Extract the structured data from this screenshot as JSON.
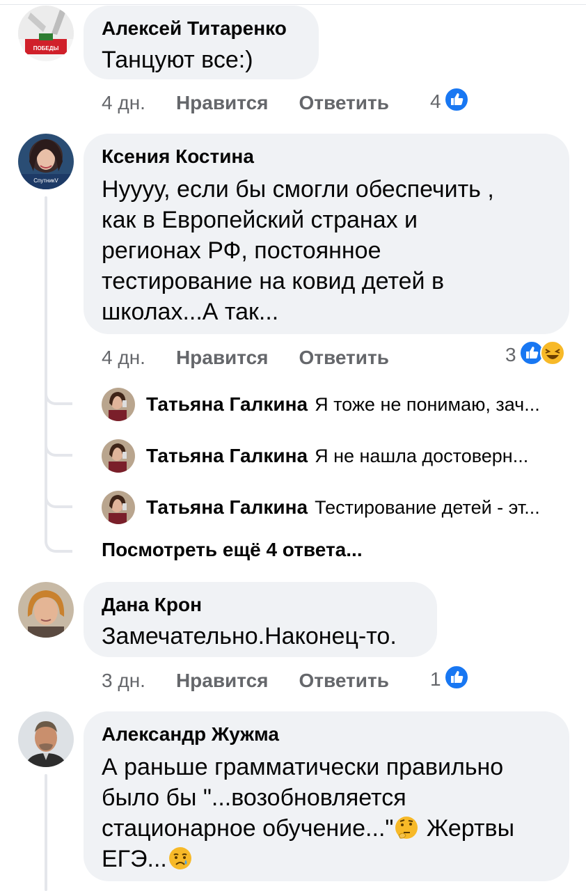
{
  "comments": [
    {
      "author": "Алексей Титаренко",
      "text": "Танцуют все:)",
      "time": "4 дн.",
      "like_label": "Нравится",
      "reply_label": "Ответить",
      "reaction_count": "4",
      "avatar_caption": "ПОБЕДЫ"
    },
    {
      "author": "Ксения Костина",
      "text_lines": [
        "Нуууу, если бы смогли обеспечить ,",
        "как в Европейский странах и",
        "регионах РФ, постоянное",
        "тестирование на ковид детей в",
        "школах...А так..."
      ],
      "time": "4 дн.",
      "like_label": "Нравится",
      "reply_label": "Ответить",
      "reaction_count": "3",
      "avatar_caption": "СпутникV",
      "replies": [
        {
          "author": "Татьяна Галкина",
          "text": "Я тоже не понимаю, зач..."
        },
        {
          "author": "Татьяна Галкина",
          "text": "Я не нашла достоверн..."
        },
        {
          "author": "Татьяна Галкина",
          "text": "Тестирование детей - эт..."
        }
      ],
      "more_replies": "Посмотреть ещё 4 ответа..."
    },
    {
      "author": "Дана Крон",
      "text": "Замечательно.Наконец-то.",
      "time": "3 дн.",
      "like_label": "Нравится",
      "reply_label": "Ответить",
      "reaction_count": "1"
    },
    {
      "author": "Александр Жужма",
      "text_lines": [
        "А раньше грамматически правильно",
        "было бы \"...возобновляется",
        "стационарное обучение...\"",
        " Жертвы",
        "ЕГЭ..."
      ]
    }
  ],
  "colors": {
    "bubble": "#f0f2f5",
    "meta": "#65676b",
    "like_blue": "#1877f2",
    "haha_yellow": "#f7b928"
  },
  "icons": [
    "like-reaction-icon",
    "haha-reaction-icon",
    "thinking-face-emoji",
    "crying-face-emoji"
  ]
}
